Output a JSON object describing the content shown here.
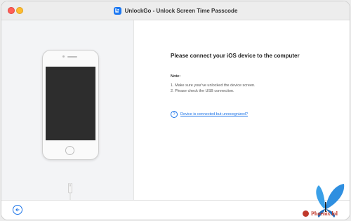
{
  "window": {
    "title": "UnlockGo - Unlock Screen Time Passcode"
  },
  "main": {
    "heading": "Please connect your iOS device to the computer",
    "note_label": "Note:",
    "notes": [
      "1. Make sure your've unlocked the device screen.",
      "2. Please check the USB connection."
    ],
    "help_link": "Device is connected but unrecognized?"
  },
  "watermark": {
    "text": "Phoenix.lol"
  },
  "colors": {
    "accent": "#1a73e8",
    "close": "#ff5f57",
    "minimize": "#febc2e"
  },
  "icons": {
    "help": "question-circle-icon",
    "back": "arrow-left-circle-icon"
  }
}
